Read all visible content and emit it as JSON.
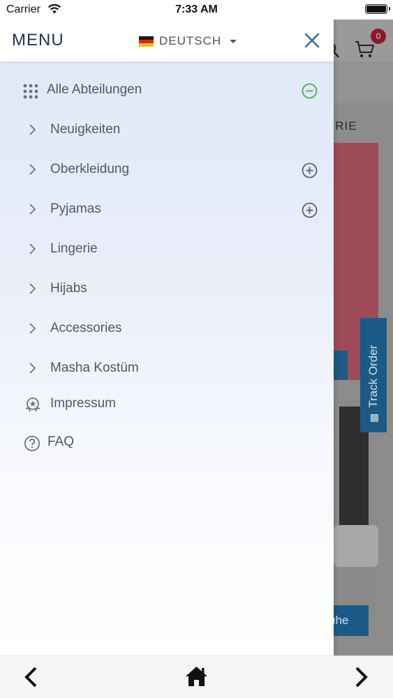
{
  "status_bar": {
    "carrier": "Carrier",
    "time": "7:33 AM"
  },
  "drawer": {
    "title": "MENU",
    "language": "DEUTSCH",
    "all_departments": "Alle Abteilungen",
    "items": [
      {
        "label": "Neuigkeiten",
        "expandable": false
      },
      {
        "label": "Oberkleidung",
        "expandable": true
      },
      {
        "label": "Pyjamas",
        "expandable": true
      },
      {
        "label": "Lingerie",
        "expandable": false
      },
      {
        "label": "Hijabs",
        "expandable": false
      },
      {
        "label": "Accessories",
        "expandable": false
      },
      {
        "label": "Masha Kostüm",
        "expandable": false
      }
    ],
    "impressum": "Impressum",
    "faq": "FAQ"
  },
  "background": {
    "cart_count": "0",
    "nav_fragment": "GRIE",
    "track_order": "Track Order",
    "button_fragment": "uhe"
  },
  "colors": {
    "title": "#1c3354",
    "close": "#2b6fa6",
    "minus_circle": "#4caf50",
    "accent_blue": "#1b5a86"
  }
}
